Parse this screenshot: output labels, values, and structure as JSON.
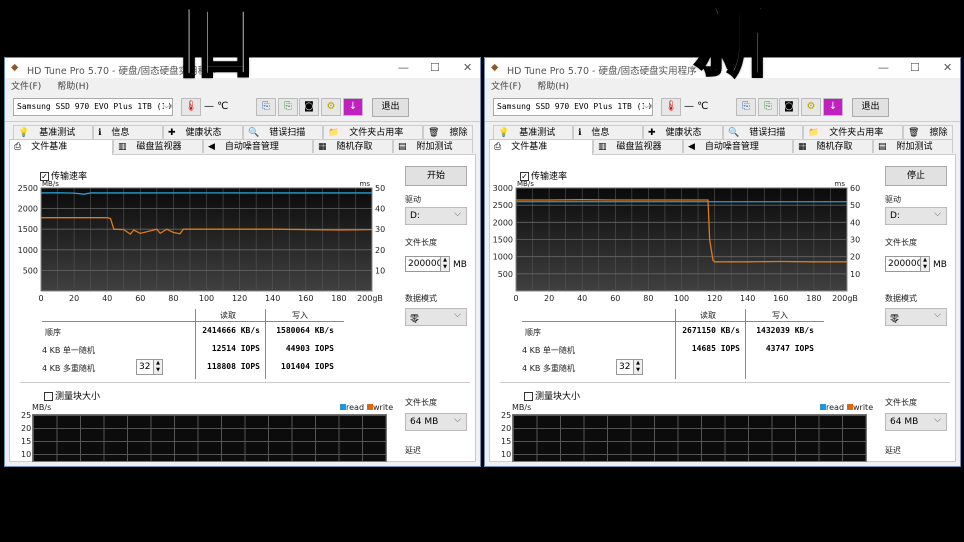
{
  "overlay": {
    "left_label": "旧",
    "right_label": "新"
  },
  "windows": [
    {
      "title": "HD Tune Pro 5.70 - 硬盘/固态硬盘实用程序",
      "menu": [
        "文件(F)",
        "帮助(H)"
      ],
      "drive": "Samsung SSD 970 EVO Plus 1TB (1000",
      "temp": "— ℃",
      "exit": "退出",
      "tabs_row1": [
        "基准测试",
        "信息",
        "健康状态",
        "错误扫描",
        "文件夹占用率",
        "擦除"
      ],
      "tabs_row2": [
        "文件基准",
        "磁盘监视器",
        "自动噪音管理",
        "随机存取",
        "附加测试"
      ],
      "transfer_checkbox": "传输速率",
      "action_button": "开始",
      "drive_label": "驱动",
      "drive_value": "D:",
      "file_length_label": "文件长度",
      "file_length_value": "200000",
      "file_length_unit": "MB",
      "data_mode_label": "数据模式",
      "data_mode_value": "零",
      "table": {
        "headers": [
          "读取",
          "写入"
        ],
        "rows": [
          {
            "label": "顺序",
            "read": "2414666 KB/s",
            "write": "1580064 KB/s"
          },
          {
            "label": "4 KB 单一随机",
            "read": "12514 IOPS",
            "write": "44903 IOPS"
          },
          {
            "label": "4 KB 多重随机",
            "read": "118808 IOPS",
            "write": "101404 IOPS"
          }
        ],
        "queue_depth": "32"
      },
      "block_checkbox": "测量块大小",
      "block_file_length_label": "文件长度",
      "block_file_length_value": "64 MB",
      "delay_label": "延迟",
      "block_chart": {
        "ylabel": "MB/s",
        "yticks": [
          "25",
          "20",
          "15",
          "10"
        ],
        "legend": [
          "read",
          "write"
        ]
      }
    },
    {
      "title": "HD Tune Pro 5.70 - 硬盘/固态硬盘实用程序",
      "menu": [
        "文件(F)",
        "帮助(H)"
      ],
      "drive": "Samsung SSD 970 EVO Plus 1TB (1000",
      "temp": "— ℃",
      "exit": "退出",
      "tabs_row1": [
        "基准测试",
        "信息",
        "健康状态",
        "错误扫描",
        "文件夹占用率",
        "擦除"
      ],
      "tabs_row2": [
        "文件基准",
        "磁盘监视器",
        "自动噪音管理",
        "随机存取",
        "附加测试"
      ],
      "transfer_checkbox": "传输速率",
      "action_button": "停止",
      "drive_label": "驱动",
      "drive_value": "D:",
      "file_length_label": "文件长度",
      "file_length_value": "200000",
      "file_length_unit": "MB",
      "data_mode_label": "数据模式",
      "data_mode_value": "零",
      "table": {
        "headers": [
          "读取",
          "写入"
        ],
        "rows": [
          {
            "label": "顺序",
            "read": "2671150 KB/s",
            "write": "1432039 KB/s"
          },
          {
            "label": "4 KB 单一随机",
            "read": "14685 IOPS",
            "write": "43747 IOPS"
          },
          {
            "label": "4 KB 多重随机",
            "read": "",
            "write": ""
          }
        ],
        "queue_depth": "32"
      },
      "block_checkbox": "测量块大小",
      "block_file_length_label": "文件长度",
      "block_file_length_value": "64 MB",
      "delay_label": "延迟",
      "block_chart": {
        "ylabel": "MB/s",
        "yticks": [
          "25",
          "20",
          "15",
          "10"
        ],
        "legend": [
          "read",
          "write"
        ]
      }
    }
  ],
  "chart_data": [
    {
      "type": "line",
      "ylabel": "MB/s",
      "y2label": "ms",
      "ylim": [
        0,
        2500
      ],
      "y2lim": [
        0,
        50
      ],
      "xlim": [
        0,
        200
      ],
      "yticks": [
        "2500",
        "2000",
        "1500",
        "1000",
        "500"
      ],
      "y2ticks": [
        "50",
        "40",
        "30",
        "20",
        "10"
      ],
      "xticks": [
        "0",
        "20",
        "40",
        "60",
        "80",
        "100",
        "120",
        "140",
        "160",
        "180",
        "200gB"
      ],
      "series": [
        {
          "color": "#2a9fd6",
          "x": [
            0,
            10,
            20,
            26,
            30,
            60,
            100,
            140,
            180,
            200
          ],
          "y": [
            2380,
            2385,
            2375,
            2350,
            2380,
            2380,
            2382,
            2380,
            2380,
            2380
          ]
        },
        {
          "color": "#e07a1a",
          "x": [
            0,
            20,
            40,
            42,
            44,
            50,
            54,
            56,
            60,
            70,
            72,
            76,
            80,
            84,
            86,
            100,
            140,
            180,
            200
          ],
          "y": [
            1780,
            1780,
            1780,
            1760,
            1500,
            1490,
            1380,
            1480,
            1400,
            1500,
            1400,
            1500,
            1420,
            1390,
            1500,
            1500,
            1500,
            1480,
            1490
          ]
        }
      ]
    },
    {
      "type": "line",
      "ylabel": "MB/s",
      "y2label": "ms",
      "ylim": [
        0,
        3000
      ],
      "y2lim": [
        0,
        60
      ],
      "xlim": [
        0,
        200
      ],
      "yticks": [
        "3000",
        "2500",
        "2000",
        "1500",
        "1000",
        "500"
      ],
      "y2ticks": [
        "60",
        "50",
        "40",
        "30",
        "20",
        "10"
      ],
      "xticks": [
        "0",
        "20",
        "40",
        "60",
        "80",
        "100",
        "120",
        "140",
        "160",
        "180",
        "200gB"
      ],
      "series": [
        {
          "color": "#2a9fd6",
          "x": [
            0,
            200
          ],
          "y": [
            2600,
            2600
          ]
        },
        {
          "color": "#e07a1a",
          "x": [
            0,
            20,
            40,
            60,
            80,
            100,
            116,
            117,
            119,
            120,
            140,
            160,
            180,
            200
          ],
          "y": [
            2650,
            2650,
            2660,
            2650,
            2650,
            2650,
            2650,
            1500,
            900,
            850,
            850,
            860,
            850,
            850
          ]
        }
      ]
    }
  ]
}
